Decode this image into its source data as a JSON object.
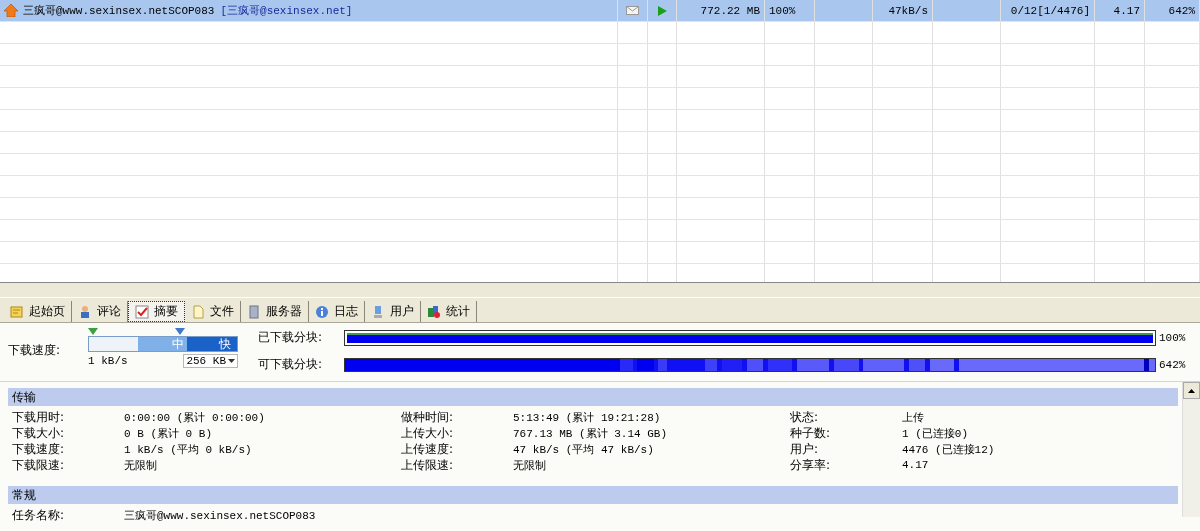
{
  "torrent_list": {
    "rows": [
      {
        "name": "三疯哥@www.sexinsex.netSCOP083",
        "tag": "[三疯哥@sexinsex.net]",
        "selected": true,
        "size": "772.22 MB",
        "progress": "100%",
        "speed": "47kB/s",
        "peers": "0/12[1/4476]",
        "ratio": "4.17",
        "availability": "642%"
      }
    ]
  },
  "tabs": [
    {
      "label": "起始页",
      "selected": false
    },
    {
      "label": "评论",
      "selected": false
    },
    {
      "label": "摘要",
      "selected": true
    },
    {
      "label": "文件",
      "selected": false
    },
    {
      "label": "服务器",
      "selected": false
    },
    {
      "label": "日志",
      "selected": false
    },
    {
      "label": "用户",
      "selected": false
    },
    {
      "label": "统计",
      "selected": false
    }
  ],
  "speed": {
    "label": "下载速度:",
    "segments": [
      "中",
      "快"
    ],
    "level": 0.61,
    "min_reading": "1 kB/s",
    "limit": "256 KB"
  },
  "chunk_bars": [
    {
      "label": "已下载分块:",
      "kind": "solid",
      "level": 1,
      "reading": "100%"
    },
    {
      "label": "可下载分块:",
      "kind": "striped",
      "reading": "642%"
    }
  ],
  "sections": [
    {
      "title": "传输",
      "columns": [
        [
          {
            "label": "下载用时:",
            "value": "0:00:00 (累计 0:00:00)"
          },
          {
            "label": "下载大小:",
            "value": "0 B (累计 0 B)"
          },
          {
            "label": "下载速度:",
            "value": "1 kB/s (平均 0 kB/s)"
          },
          {
            "label": "下载限速:",
            "value": "无限制"
          }
        ],
        [
          {
            "label": "做种时间:",
            "value": "5:13:49 (累计 19:21:28)"
          },
          {
            "label": "上传大小:",
            "value": "767.13 MB (累计 3.14 GB)"
          },
          {
            "label": "上传速度:",
            "value": "47 kB/s (平均 47 kB/s)"
          },
          {
            "label": "上传限速:",
            "value": "无限制"
          }
        ],
        [
          {
            "label": "状态:",
            "value": "上传"
          },
          {
            "label": "种子数:",
            "value": "1 (已连接0)"
          },
          {
            "label": "用户:",
            "value": "4476 (已连接12)"
          },
          {
            "label": "分享率:",
            "value": "4.17"
          }
        ]
      ]
    },
    {
      "title": "常规",
      "columns": [
        [
          {
            "label": "任务名称:",
            "value": "三疯哥@www.sexinsex.netSCOP083"
          }
        ]
      ]
    }
  ]
}
